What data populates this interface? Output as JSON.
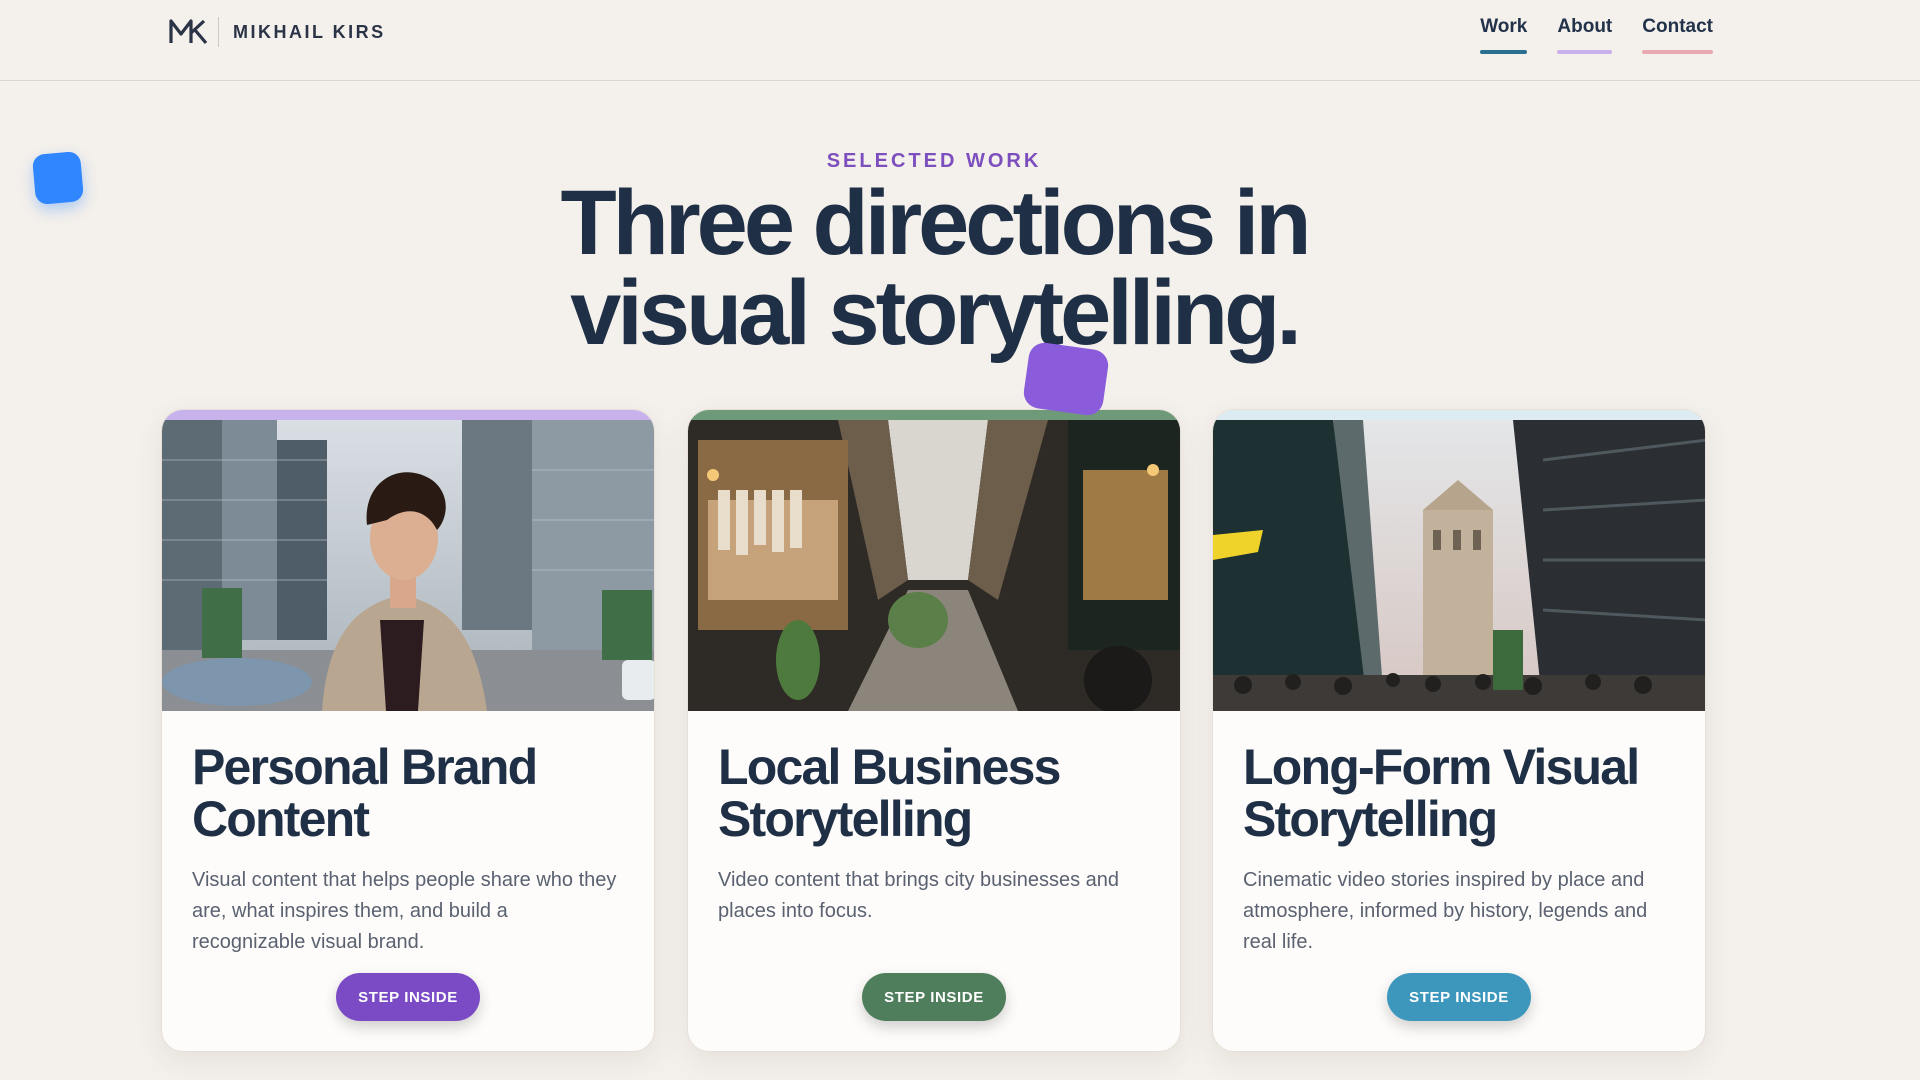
{
  "brand": {
    "name": "MIKHAIL KIRS"
  },
  "nav": [
    {
      "label": "Work",
      "color": "#2a6f8f"
    },
    {
      "label": "About",
      "color": "#c9b1ec"
    },
    {
      "label": "Contact",
      "color": "#e9a9b3"
    }
  ],
  "hero": {
    "eyebrow": "SELECTED WORK",
    "title_line1": "Three directions in",
    "title_line2": "visual storytelling."
  },
  "cards": [
    {
      "title_line1": "Personal Brand",
      "title_line2": "Content",
      "description": "Visual content that helps people share who they are, what inspires them, and build a recognizable visual brand.",
      "button": "STEP INSIDE",
      "accent": "#7a4bc5",
      "top_color": "#c8b2ec",
      "image": "woman-in-city-photo"
    },
    {
      "title_line1": "Local Business",
      "title_line2": "Storytelling",
      "description": "Video content that brings city businesses and places into focus.",
      "button": "STEP INSIDE",
      "accent": "#4f7e5c",
      "top_color": "#6f9a7a",
      "image": "shopping-arcade-photo"
    },
    {
      "title_line1": "Long-Form Visual",
      "title_line2": "Storytelling",
      "description": "Cinematic video stories inspired by place and atmosphere, informed by history, legends and real life.",
      "button": "STEP INSIDE",
      "accent": "#3d97bd",
      "top_color": "#dcecf2",
      "image": "tower-bridge-street-photo"
    }
  ]
}
